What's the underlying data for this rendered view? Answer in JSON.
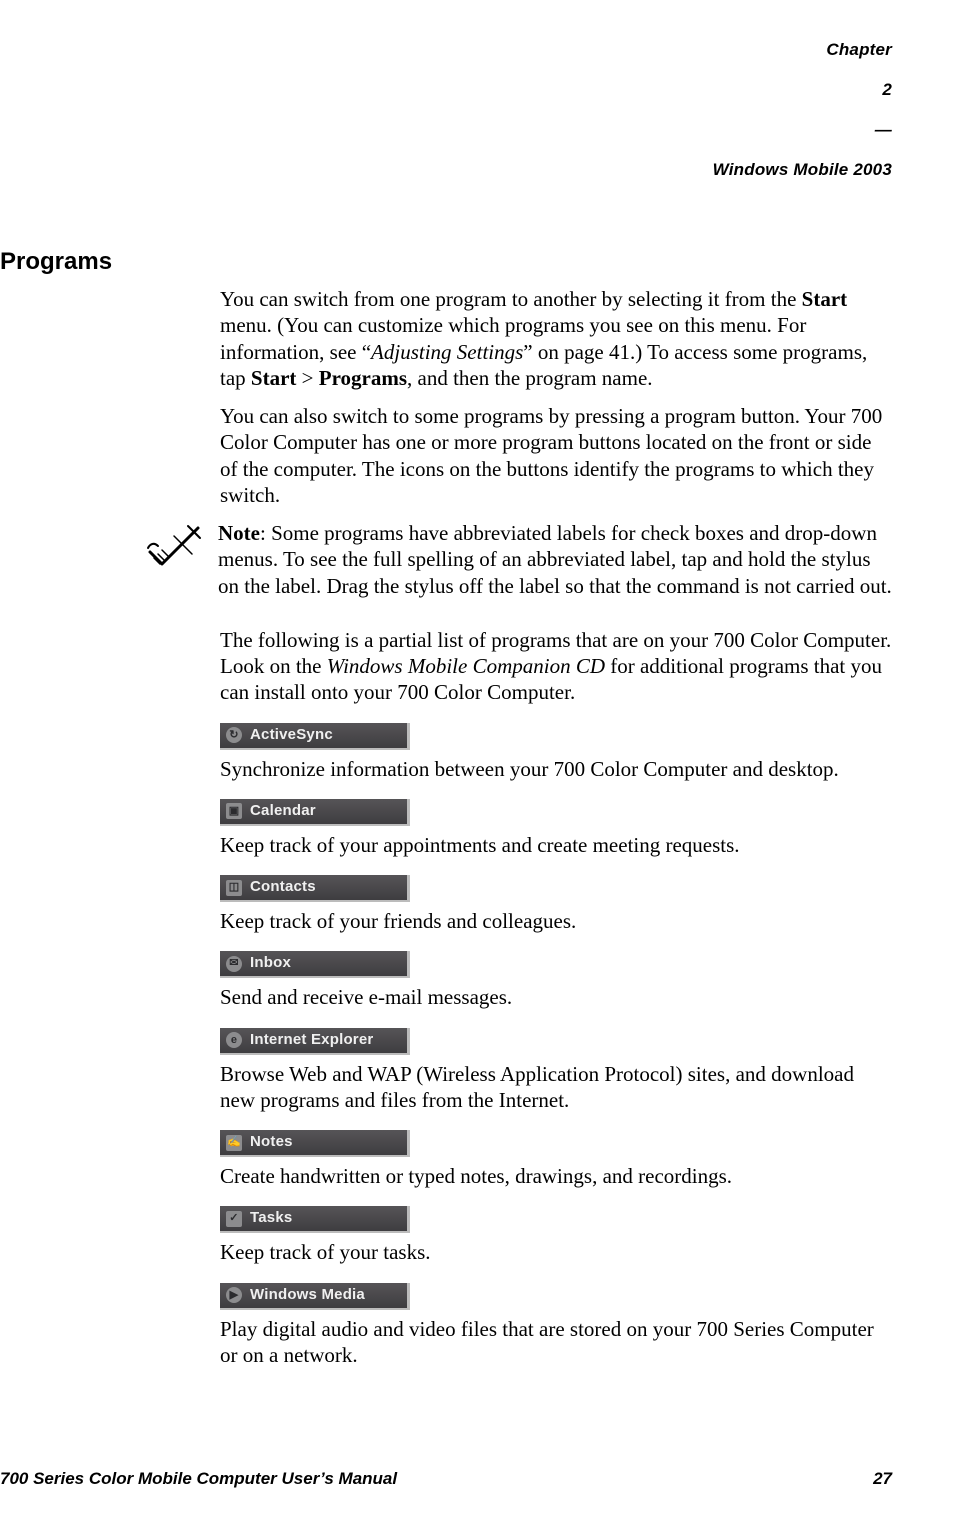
{
  "header": {
    "chapter": "Chapter",
    "chapter_no": "2",
    "sep": "—",
    "title": "Windows Mobile 2003"
  },
  "section_title": "Programs",
  "para1_pre": "You can switch from one program to another by selecting it from the ",
  "para1_b1": "Start",
  "para1_mid1": " menu. (You can customize which programs you see on this menu. For information, see “",
  "para1_i1": "Adjusting Settings",
  "para1_mid2": "” on page 41.) To access some programs, tap ",
  "para1_b2": "Start",
  "para1_gt": " > ",
  "para1_b3": "Programs",
  "para1_post": ", and then the program name.",
  "para2": "You can also switch to some programs by pressing a program button. Your 700 Color Computer has one or more program buttons located on the front or side of the computer. The icons on the buttons identify the programs to which they switch.",
  "note_b": "Note",
  "note_text": ": Some programs have abbreviated labels for check boxes and drop-down menus. To see the full spelling of an abbreviated label, tap and hold the stylus on the label. Drag the stylus off the label so that the command is not carried out.",
  "para3_pre": "The following is a partial list of programs that are on your 700 Color Computer. Look on the ",
  "para3_i": "Windows Mobile Companion CD",
  "para3_post": " for additional programs that you can install onto your 700 Color Computer.",
  "programs": [
    {
      "label": "ActiveSync",
      "glyph": "↻",
      "shape": "round",
      "desc": "Synchronize information between your 700 Color Computer and desktop."
    },
    {
      "label": "Calendar",
      "glyph": "▣",
      "shape": "",
      "desc": "Keep track of your appointments and create meeting requests."
    },
    {
      "label": "Contacts",
      "glyph": "◫",
      "shape": "",
      "desc": "Keep track of your friends and colleagues."
    },
    {
      "label": "Inbox",
      "glyph": "✉",
      "shape": "round",
      "desc": "Send and receive e-mail messages."
    },
    {
      "label": "Internet Explorer",
      "glyph": "e",
      "shape": "round",
      "desc": "Browse Web and WAP (Wireless Application Protocol) sites, and download new programs and files from the Internet."
    },
    {
      "label": "Notes",
      "glyph": "✍",
      "shape": "",
      "desc": "Create handwritten or typed notes, drawings, and recordings."
    },
    {
      "label": "Tasks",
      "glyph": "✓",
      "shape": "",
      "desc": "Keep track of your tasks."
    },
    {
      "label": "Windows Media",
      "glyph": "▶",
      "shape": "round",
      "desc": "Play digital audio and video files that are stored on your 700 Series Computer or on a network."
    }
  ],
  "footer": {
    "left": "700 Series Color Mobile Computer User’s Manual",
    "right": "27"
  }
}
